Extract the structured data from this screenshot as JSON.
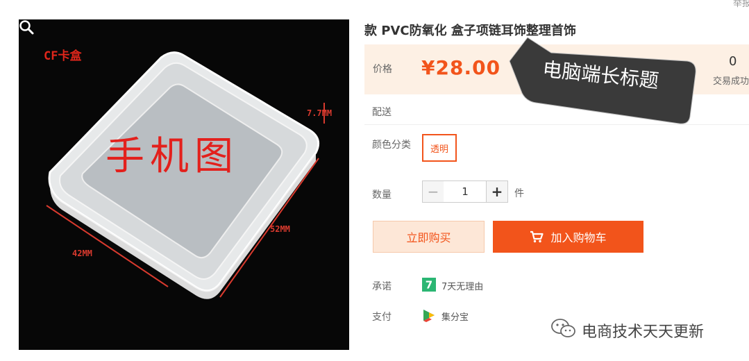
{
  "header": {
    "report_text": "举报"
  },
  "product": {
    "title": "款 PVC防氧化 盒子项链耳饰整理首饰",
    "image": {
      "label_cf": "CF卡盒",
      "label_phone": "手机图",
      "dim_thickness": "7.7MM",
      "dim_length": "52MM",
      "dim_width": "42MM",
      "zoom_icon": "search-icon"
    }
  },
  "price_section": {
    "label": "价格",
    "value": "¥28.00",
    "sales_count": "0",
    "sales_label": "交易成功"
  },
  "watermark": {
    "callout_text": "电脑端长标题"
  },
  "delivery": {
    "label": "配送"
  },
  "color": {
    "label": "颜色分类",
    "options": [
      "透明"
    ],
    "selected": "透明"
  },
  "quantity": {
    "label": "数量",
    "value": "1",
    "unit": "件",
    "minus": "−",
    "plus": "+"
  },
  "actions": {
    "buy_now": "立即购买",
    "add_to_cart": "加入购物车",
    "cart_icon": "cart-icon"
  },
  "promise": {
    "label": "承诺",
    "badge": "7",
    "text": "7天无理由"
  },
  "payment": {
    "label": "支付",
    "text": "集分宝"
  },
  "wechat_watermark": {
    "icon": "wechat-icon",
    "text": "电商技术天天更新"
  },
  "colors": {
    "accent": "#f2541b",
    "price_bg": "#fdf0e4",
    "promise_green": "#2bb673"
  }
}
